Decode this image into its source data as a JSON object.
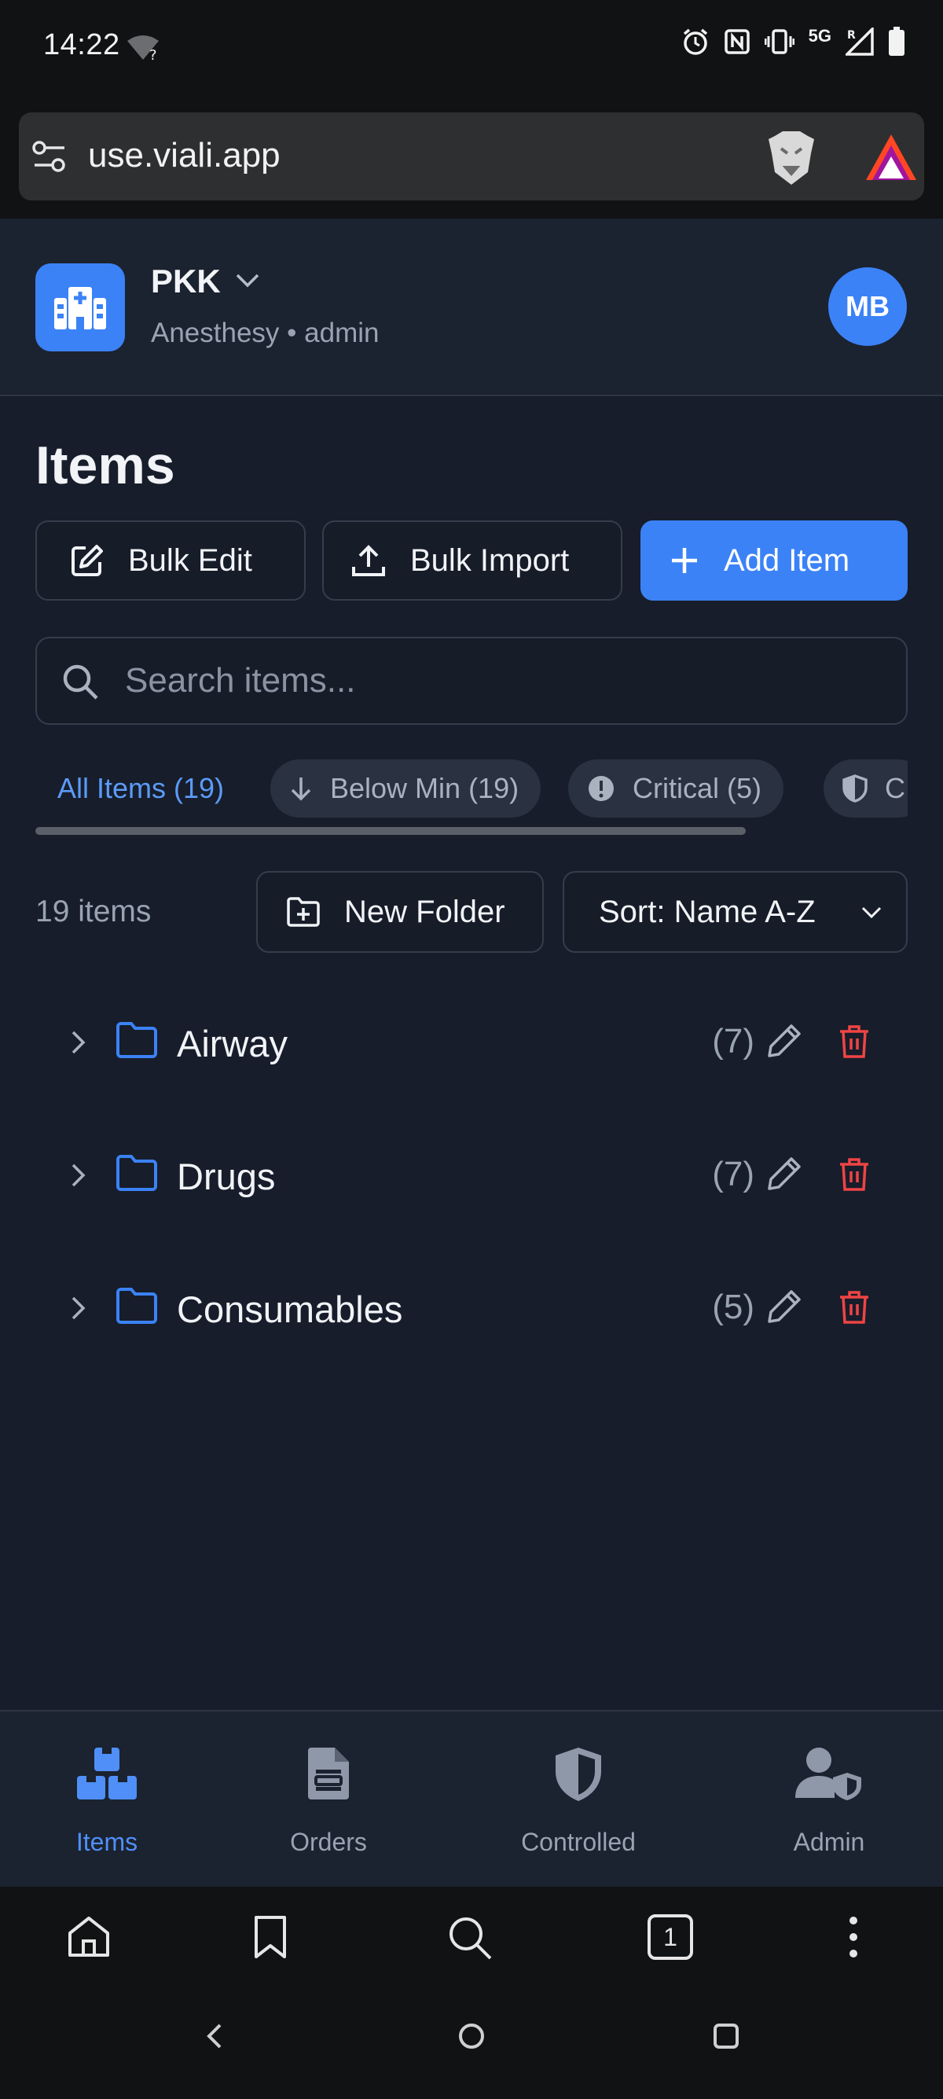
{
  "status_bar": {
    "time": "14:22",
    "network": "5G",
    "network_sub": "R",
    "wifi_badge": "?"
  },
  "browser": {
    "url": "use.viali.app",
    "tabs_count": "1"
  },
  "header": {
    "org_name": "PKK",
    "org_subtitle": "Anesthesy • admin",
    "avatar_initials": "MB"
  },
  "page": {
    "title": "Items"
  },
  "toolbar": {
    "bulk_edit": "Bulk Edit",
    "bulk_import": "Bulk Import",
    "add_item": "Add Item"
  },
  "search": {
    "placeholder": "Search items...",
    "value": ""
  },
  "filters": [
    {
      "label": "All Items (19)",
      "active": true
    },
    {
      "label": "Below Min (19)",
      "icon": "arrow-down-icon"
    },
    {
      "label": "Critical (5)",
      "icon": "alert-circle-icon"
    },
    {
      "label": "C",
      "icon": "shield-icon"
    }
  ],
  "list_controls": {
    "count_label": "19 items",
    "new_folder": "New Folder",
    "sort_label": "Sort: Name A-Z"
  },
  "folders": [
    {
      "name": "Airway",
      "count": "(7)"
    },
    {
      "name": "Drugs",
      "count": "(7)"
    },
    {
      "name": "Consumables",
      "count": "(5)"
    }
  ],
  "bottom_nav": [
    {
      "label": "Items",
      "icon": "boxes-icon",
      "active": true
    },
    {
      "label": "Orders",
      "icon": "clipboard-icon"
    },
    {
      "label": "Controlled",
      "icon": "shield-icon"
    },
    {
      "label": "Admin",
      "icon": "user-shield-icon"
    }
  ],
  "colors": {
    "accent": "#3b82f6",
    "danger": "#ef4444",
    "background": "#171d2a"
  }
}
